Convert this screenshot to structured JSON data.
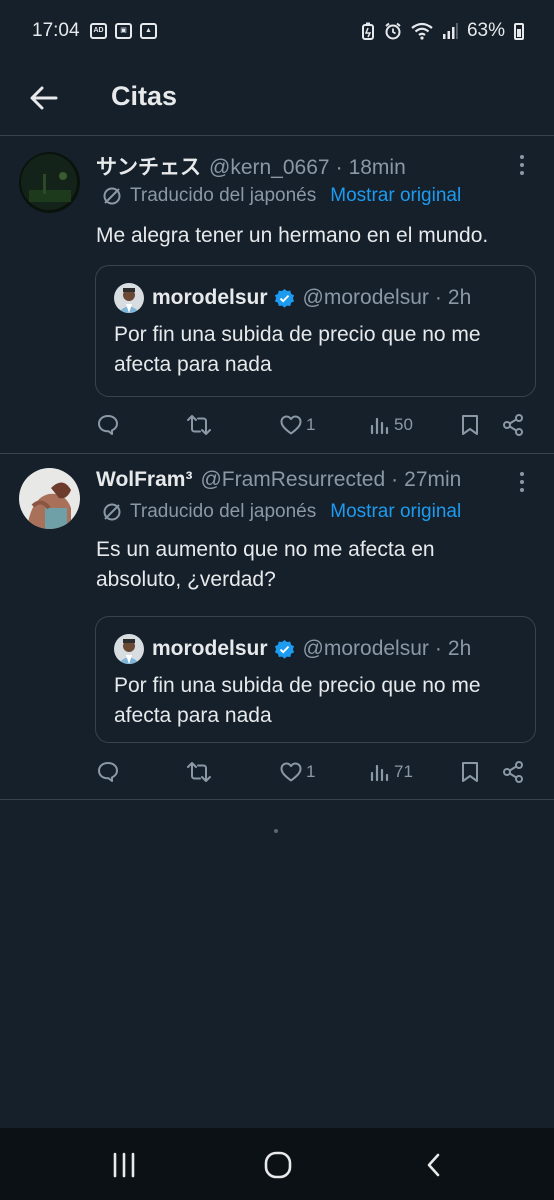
{
  "status_bar": {
    "time": "17:04",
    "battery": "63%",
    "left_icons": [
      "ad-icon",
      "app-icon",
      "image-icon"
    ],
    "right_icons": [
      "battery-saver-icon",
      "alarm-icon",
      "wifi-icon",
      "signal-icon",
      "battery-icon"
    ]
  },
  "header": {
    "title": "Citas",
    "back_icon": "arrow-left-icon"
  },
  "colors": {
    "background": "#15202b",
    "text": "#e7e9ea",
    "muted": "#8b98a5",
    "link": "#1d9bf0",
    "border": "#38444d",
    "verified": "#1d9bf0"
  },
  "tweets": [
    {
      "name": "サンチェス",
      "handle": "@kern_0667",
      "separator": "·",
      "time": "18min",
      "translated_label": "Traducido del japonés",
      "show_original": "Mostrar original",
      "text": "Me alegra tener un hermano en el mundo.",
      "quote": {
        "name": "morodelsur",
        "handle": "@morodelsur",
        "separator": "·",
        "time": "2h",
        "text": "Por fin una subida de precio que no me afecta para nada"
      },
      "actions": {
        "replies": "",
        "retweets": "",
        "likes": "1",
        "views": "50"
      }
    },
    {
      "name": "WolFram³",
      "handle": "@FramResurrected",
      "separator": "·",
      "time": "27min",
      "translated_label": "Traducido del japonés",
      "show_original": "Mostrar original",
      "text": "Es un aumento que no me afecta en absoluto, ¿verdad?",
      "quote": {
        "name": "morodelsur",
        "handle": "@morodelsur",
        "separator": "·",
        "time": "2h",
        "text": "Por fin una subida de precio que no me afecta para nada"
      },
      "actions": {
        "replies": "",
        "retweets": "",
        "likes": "1",
        "views": "71"
      }
    }
  ],
  "nav_bar": {
    "icons": [
      "recent-apps-icon",
      "home-icon",
      "back-icon"
    ]
  }
}
